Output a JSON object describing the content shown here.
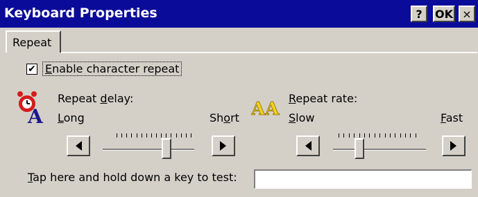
{
  "window": {
    "title": "Keyboard Properties",
    "help_label": "?",
    "ok_label": "OK",
    "close_label": "×"
  },
  "tabs": [
    {
      "label": "Repeat",
      "selected": true
    }
  ],
  "enable_repeat": {
    "label_first": "E",
    "label_rest": "nable character repeat",
    "checked": true,
    "check_glyph": "✔"
  },
  "repeat_delay": {
    "label_pre": "Repeat ",
    "label_u": "d",
    "label_post": "elay:",
    "min_label_u": "L",
    "min_label_rest": "ong",
    "max_label_pre": "Sh",
    "max_label_u": "o",
    "max_label_post": "rt",
    "level": 0.72,
    "icon": "alarm-clock-icon",
    "icon_letter": "A"
  },
  "repeat_rate": {
    "label_pre": "",
    "label_u": "R",
    "label_post": "epeat rate:",
    "min_label_u": "S",
    "min_label_rest": "low",
    "max_label_u": "F",
    "max_label_rest": "ast",
    "level": 0.26,
    "icon": "aa-letters-icon",
    "icon_letters": "AA"
  },
  "test_field": {
    "label_u": "T",
    "label_rest": "ap here and hold down a key to test:",
    "value": ""
  },
  "colors": {
    "titlebar": "#0b0b9a",
    "face": "#d4d0c8",
    "clock_red": "#d41c1c",
    "letter_blue": "#1a1a8c",
    "aa_yellow": "#f2d21b"
  }
}
